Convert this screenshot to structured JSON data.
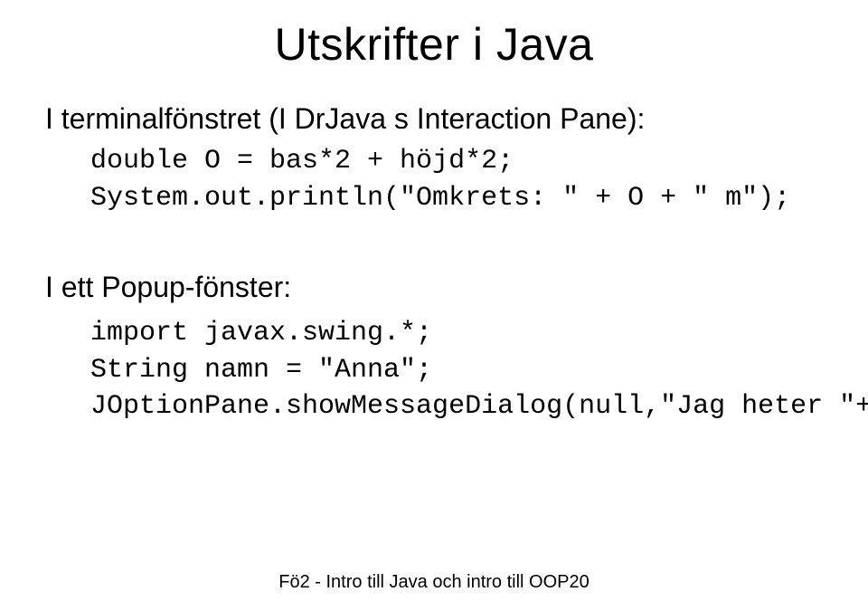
{
  "title": "Utskrifter i Java",
  "section1": {
    "heading": "I terminalfönstret (I DrJava s Interaction Pane):",
    "code_line1": "double O = bas*2 + höjd*2;",
    "code_line2": "System.out.println(\"Omkrets: \" + O + \" m\");"
  },
  "section2": {
    "heading": "I ett Popup-fönster:",
    "code_line1": "import javax.swing.*;",
    "code_line2": "String namn = \"Anna\";",
    "code_line3": "JOptionPane.showMessageDialog(null,\"Jag heter \"+namn);"
  },
  "footer": "Fö2 - Intro till Java och intro till OOP20"
}
